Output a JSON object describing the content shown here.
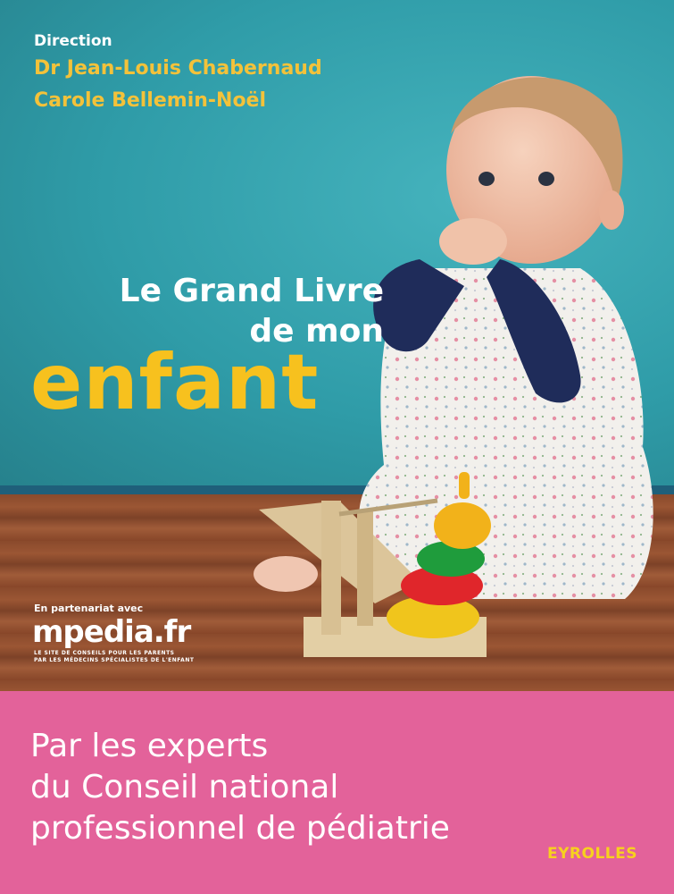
{
  "cover": {
    "credit_heading": "Direction",
    "authors": [
      "Dr Jean-Louis Chabernaud",
      "Carole Bellemin-Noël"
    ],
    "title": [
      "Le Grand Livre",
      "de mon",
      "enfant"
    ],
    "partner": {
      "lead": "En partenariat avec",
      "logo": "mpedia.fr",
      "tagline": [
        "LE SITE DE CONSEILS POUR LES PARENTS",
        "PAR LES MÉDECINS SPÉCIALISTES DE L'ENFANT"
      ]
    },
    "subtitle": [
      "Par les experts",
      "du Conseil national",
      "professionnel de pédiatrie"
    ],
    "publisher": "EYROLLES"
  },
  "colors": {
    "wall": "#2e9aa6",
    "author_yellow": "#f3c23a",
    "title_yellow": "#f7c11e",
    "band_pink": "#e3629a",
    "publisher_yellow": "#f7d11e"
  },
  "image": {
    "subject": "baby-with-stacking-toy-photo"
  }
}
